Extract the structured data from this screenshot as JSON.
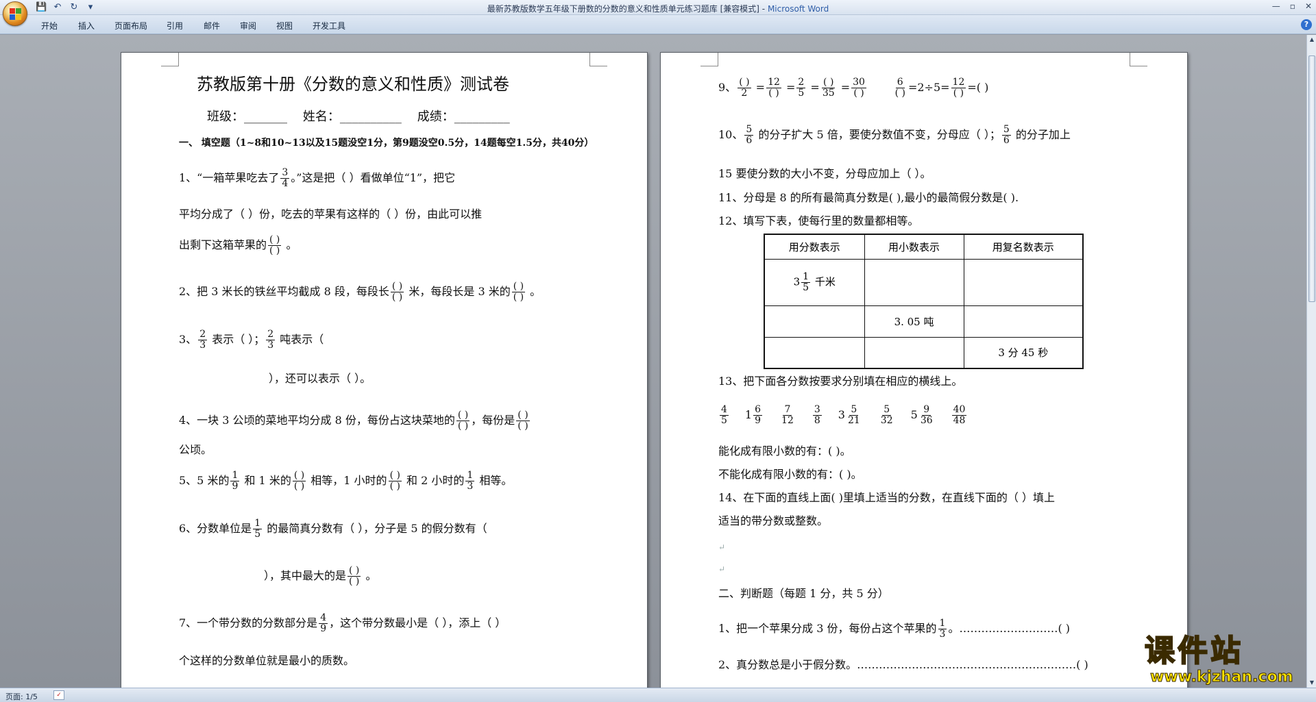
{
  "window": {
    "title": "最新苏教版数学五年级下册数的分数的意义和性质单元练习题库 [兼容模式]",
    "app_name": "Microsoft Word",
    "separator": " - "
  },
  "qat": {
    "save": "💾",
    "undo": "↶",
    "redo": "↻",
    "more": "▾"
  },
  "tabs": [
    "开始",
    "插入",
    "页面布局",
    "引用",
    "邮件",
    "审阅",
    "视图",
    "开发工具"
  ],
  "help": "?",
  "status": {
    "page": "页面: 1/5"
  },
  "colors": {
    "accent": "#2f5ea8",
    "watermark": "#ffe400"
  },
  "page1": {
    "title": "苏教版第十册《分数的意义和性质》测试卷",
    "header": {
      "class_label": "班级：",
      "name_label": "姓名：",
      "score_label": "成绩：",
      "blank_short": "_______",
      "blank_long": "__________",
      "blank_mid": "_________"
    },
    "sec1": "一、  填空题（1~8和10~13以及15题没空1分，第9题没空0.5分，14题每空1.5分，共40分）",
    "q1a": "1、“一箱苹果吃去了",
    "q1b": "。”这是把（                    ）看做单位“1”，把它",
    "q1c": "平均分成了（        ）份，吃去的苹果有这样的（          ）份，由此可以推",
    "q1d": "出剩下这箱苹果的",
    "q2a": "2、把 3 米长的铁丝平均截成 8 段，每段长",
    "q2b": " 米，每段长是 3 米的",
    "q3a": "3、",
    "q3b": " 表示（                              ）；",
    "q3c": " 吨表示（",
    "q3d": "），还可以表示（                                                  ）。",
    "q4a": "4、一块 3 公顷的菜地平均分成 8 份，每份占这块菜地的",
    "q4b": "，每份是",
    "q4c": "公顷。",
    "q5a": "5、5 米的",
    "q5b": " 和 1 米的",
    "q5c": " 相等，1 小时的",
    "q5d": " 和 2 小时的",
    "q5e": " 相等。",
    "q6a": "6、分数单位是",
    "q6b": " 的最简真分数有（              ），分子是 5 的假分数有（",
    "q6c": "），其中最大的是",
    "q7a": "7、一个带分数的分数部分是",
    "q7b": "，这个带分数最小是（          ），添上（        ）",
    "q7c": "个这样的分数单位就是最小的质数。",
    "blank_frac": {
      "n": "(      )",
      "d": "(      )"
    },
    "f34": {
      "n": "3",
      "d": "4"
    },
    "f23": {
      "n": "2",
      "d": "3"
    },
    "f19": {
      "n": "1",
      "d": "9"
    },
    "f13": {
      "n": "1",
      "d": "3"
    },
    "f15": {
      "n": "1",
      "d": "5"
    },
    "f49": {
      "n": "4",
      "d": "9"
    }
  },
  "page2": {
    "q9": {
      "label": "9、",
      "f1": {
        "n": "(    )",
        "d": "2"
      },
      "f2": {
        "n": "12",
        "d": "(    )"
      },
      "f3": {
        "n": "2",
        "d": "5"
      },
      "f4": {
        "n": "(    )",
        "d": "35"
      },
      "f5": {
        "n": "30",
        "d": "(    )"
      },
      "f6": {
        "n": "6",
        "d": "(    )"
      },
      "f7": {
        "n": "12",
        "d": "(    )"
      },
      "eq": "=",
      "mid": "=2÷5=",
      "tail": "=(        )"
    },
    "q10a": "10、",
    "q10b": " 的分子扩大 5 倍，要使分数值不变，分母应（            ）；",
    "q10c": " 的分子加上",
    "q10d": "15 要使分数的大小不变，分母应加上（          ）。",
    "f56": {
      "n": "5",
      "d": "6"
    },
    "q11": "11、分母是 8 的所有最简真分数是(                ),最小的最简假分数是(        ).",
    "q12": "12、填写下表，使每行里的数量都相等。",
    "table": {
      "headers": [
        "用分数表示",
        "用小数表示",
        "用复名数表示"
      ],
      "r1c1_whole": "3",
      "r1c1_frac": {
        "n": "1",
        "d": "5"
      },
      "r1c1_unit": " 千米",
      "r2c2": "3. 05 吨",
      "r3c3": "3 分 45 秒"
    },
    "q13": "13、把下面各分数按要求分别填在相应的横线上。",
    "q13_fracs": [
      {
        "w": "",
        "n": "4",
        "d": "5"
      },
      {
        "w": "1",
        "n": "6",
        "d": "9"
      },
      {
        "w": "",
        "n": "7",
        "d": "12"
      },
      {
        "w": "",
        "n": "3",
        "d": "8"
      },
      {
        "w": "3",
        "n": "5",
        "d": "21"
      },
      {
        "w": "",
        "n": "5",
        "d": "32"
      },
      {
        "w": "5",
        "n": "9",
        "d": "36"
      },
      {
        "w": "",
        "n": "40",
        "d": "48"
      }
    ],
    "q13a": "能化成有限小数的有：(                                                          )。",
    "q13b": "不能化成有限小数的有：(                                                        )。",
    "q14a": "14、在下面的直线上面(      )里填上适当的分数，在直线下面的（      ）填上",
    "q14b": "适当的带分数或整数。",
    "sec2": "二、判断题（每题 1 分，共 5 分）",
    "j1a": "1、把一个苹果分成 3 份，每份占这个苹果的",
    "j1b": "。………………………(            )",
    "j2": "2、真分数总是小于假分数。……………………………………………………(            )",
    "mark": "↵"
  },
  "watermark": {
    "big": "课件站",
    "url": "www.kjzhan.com"
  }
}
